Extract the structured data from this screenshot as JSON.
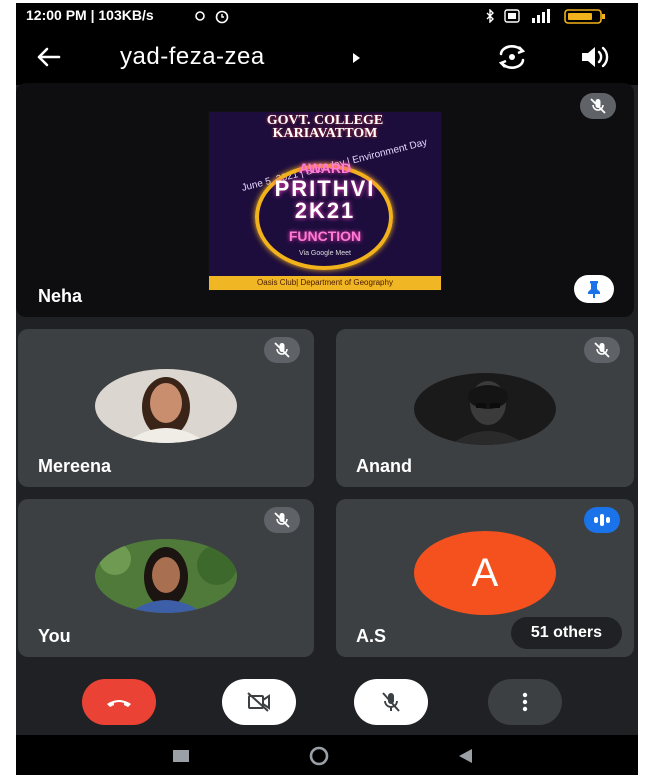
{
  "status_bar": {
    "time_info": "12:00 PM | 103KB/s",
    "right_icons": [
      "bluetooth-icon",
      "sim-icon",
      "signal-icon",
      "battery-icon"
    ]
  },
  "header": {
    "meeting_code": "yad-feza-zea"
  },
  "participants": {
    "featured": {
      "name": "Neha",
      "poster": {
        "college": "GOVT. COLLEGE\nKARIAVATTOM",
        "date_line": "June 5, 2021 | Saturday | Environment Day",
        "award": "AWARD",
        "event": "PRITHVI\n2K21",
        "function": "FUNCTION",
        "via": "Via Google Meet",
        "footer": "Oasis Club| Department of Geography"
      }
    },
    "tile_1": {
      "name": "Mereena"
    },
    "tile_2": {
      "name": "Anand"
    },
    "tile_3": {
      "name": "You"
    },
    "tile_4": {
      "name": "A.S",
      "initial": "A",
      "others_label": "51 others"
    }
  },
  "colors": {
    "end_call": "#ea4335",
    "avatar_as": "#f4511e",
    "speaking": "#1a73e8",
    "tile": "#3c4043"
  }
}
